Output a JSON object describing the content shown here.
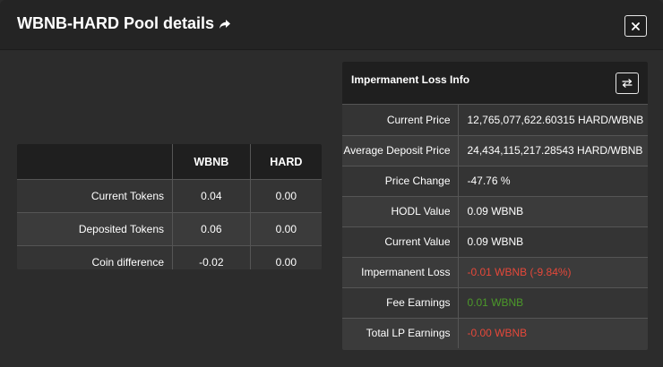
{
  "modal": {
    "title": "WBNB-HARD Pool details",
    "close_label": "×"
  },
  "tokens": {
    "columns": [
      "WBNB",
      "HARD"
    ],
    "rows": [
      {
        "label": "Current Tokens",
        "wbnb": "0.04",
        "hard": "0.00"
      },
      {
        "label": "Deposited Tokens",
        "wbnb": "0.06",
        "hard": "0.00"
      },
      {
        "label": "Coin difference",
        "wbnb": "-0.02",
        "hard": "0.00"
      }
    ]
  },
  "impermanent_loss": {
    "title": "Impermanent Loss Info",
    "rows": [
      {
        "label": "Current Price",
        "value": "12,765,077,622.60315 HARD/WBNB"
      },
      {
        "label": "Average Deposit Price",
        "value": "24,434,115,217.28543 HARD/WBNB"
      },
      {
        "label": "Price Change",
        "value": "-47.76 %"
      },
      {
        "label": "HODL Value",
        "value": "0.09 WBNB"
      },
      {
        "label": "Current Value",
        "value": "0.09 WBNB"
      },
      {
        "label": "Impermanent Loss",
        "value": "-0.01 WBNB (-9.84%)"
      },
      {
        "label": "Fee Earnings",
        "value": "0.01 WBNB"
      },
      {
        "label": "Total LP Earnings",
        "value": "-0.00 WBNB"
      }
    ]
  },
  "colors": {
    "negative": "#e5483a",
    "positive": "#4c9a2a"
  },
  "icons": {
    "title_icon": "share-icon",
    "close": "close-icon",
    "swap": "swap-icon"
  }
}
